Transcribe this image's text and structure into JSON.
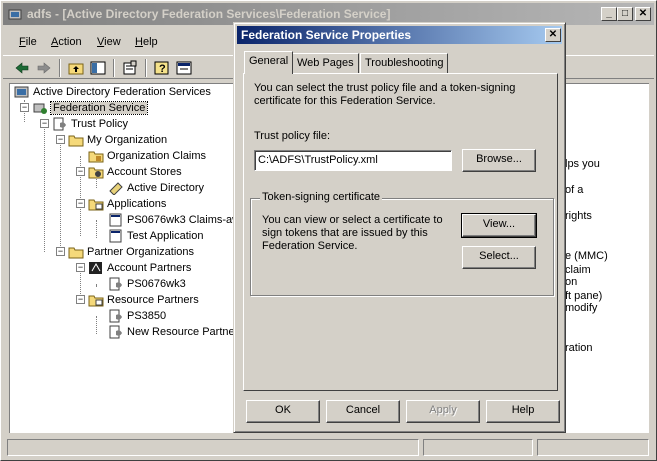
{
  "main_window": {
    "title": "adfs - [Active Directory Federation Services\\Federation Service]",
    "menu": [
      "File",
      "Action",
      "View",
      "Help"
    ],
    "menu_underline": [
      "F",
      "A",
      "V",
      "H"
    ]
  },
  "toolbar": {
    "icons": [
      "back-arrow-icon",
      "forward-arrow-icon",
      "up-folder-icon",
      "show-hide-tree-icon",
      "properties-icon",
      "help-icon",
      "console-window-icon"
    ]
  },
  "tree": {
    "root": "Active Directory Federation Services",
    "federation_service": "Federation Service",
    "trust_policy": "Trust Policy",
    "my_organization": "My Organization",
    "organization_claims": "Organization Claims",
    "account_stores": "Account Stores",
    "active_directory": "Active Directory",
    "applications": "Applications",
    "app1": "PS0676wk3 Claims-aw",
    "app2": "Test Application",
    "partner_organizations": "Partner Organizations",
    "account_partners": "Account Partners",
    "account_partner1": "PS0676wk3",
    "resource_partners": "Resource Partners",
    "resource_partner1": "PS3850",
    "resource_partner2": "New Resource Partne"
  },
  "right_pane": {
    "lines": [
      "lps you",
      "of a",
      "",
      "rights",
      "",
      "",
      "e (MMC)",
      "claim",
      "on",
      "ft pane)",
      "modify",
      "",
      "",
      "ration"
    ]
  },
  "dialog": {
    "title": "Federation Service Properties",
    "close_glyph": "✕",
    "tabs": [
      "General",
      "Web Pages",
      "Troubleshooting"
    ],
    "description": [
      "You can select the trust policy file and a token-signing",
      "certificate for this Federation Service."
    ],
    "trust_policy_label": "Trust policy file:",
    "trust_policy_value": "C:\\ADFS\\TrustPolicy.xml",
    "browse_label": "Browse...",
    "group_title": "Token-signing certificate",
    "group_text": [
      "You can view or select a certificate to",
      "sign tokens that are issued by this",
      "Federation Service."
    ],
    "view_label": "View...",
    "select_label": "Select...",
    "ok_label": "OK",
    "cancel_label": "Cancel",
    "apply_label": "Apply",
    "help_label": "Help"
  },
  "colors": {
    "dialog_title_start": "#0a246a",
    "dialog_title_end": "#a6caf0",
    "inactive_title": "#808080",
    "face": "#d4d0c8"
  }
}
